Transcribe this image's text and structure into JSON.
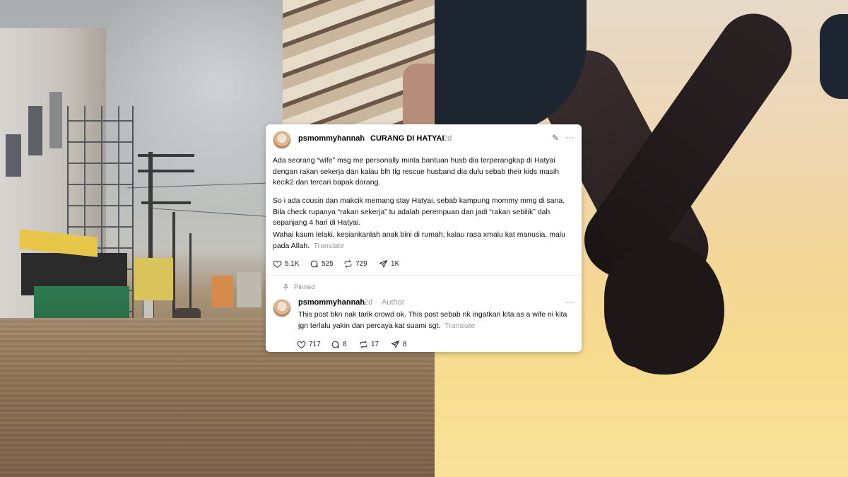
{
  "post": {
    "username": "psmommyhannah",
    "community": "CURANG DI HATYAI",
    "time": "2d",
    "paragraphs": [
      "Ada seorang “wife” msg me personally minta bantuan husb dia terperangkap di Hatyai dengan rakan sekerja dan kalau blh tlg rescue husband dia dulu sebab their kids masih kecik2 dan tercari bapak dorang.",
      "So i ada cousin dan makcik memang stay Hatyai, sebab kampung mommy mmg di sana. Bila check rupanya “rakan sekerja” tu adalah perempuan dan jadi “rakan sebilik” dah sepanjang 4 hari di Hatyai.",
      "Wahai kaum lelaki, kesiankanlah anak bini di rumah, kalau rasa xmalu kat manusia, malu pada Allah."
    ],
    "translate_label": "Translate",
    "likes": "5.1K",
    "replies": "525",
    "reposts": "729",
    "shares": "1K"
  },
  "reply": {
    "pinned_label": "Pinned",
    "username": "psmommyhannah",
    "time": "2d",
    "role": "Author",
    "text": "This post bkn nak tarik crowd ok. This post sebab nk ingatkan kita as a wife ni kita jgn terlalu yakin dan percaya kat suami sgt.",
    "translate_label": "Translate",
    "likes": "717",
    "replies": "8",
    "reposts": "17",
    "shares": "8"
  },
  "icons": {
    "chevron": "›",
    "edit": "✎",
    "more": "···",
    "separator": "·"
  }
}
